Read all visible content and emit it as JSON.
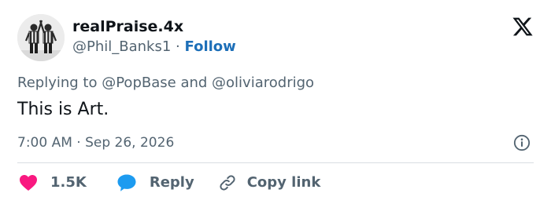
{
  "author": {
    "display_name": "realPraise.4x",
    "handle": "@Phil_Banks1",
    "separator": "·",
    "follow_label": "Follow"
  },
  "reply_context": {
    "prefix": "Replying to",
    "mention_1": "@PopBase",
    "conjunction": "and",
    "mention_2": "@oliviarodrigo"
  },
  "tweet": {
    "text": "This is Art.",
    "time": "7:00 AM",
    "separator": "·",
    "date": "Sep 26, 2026"
  },
  "actions": {
    "likes_count": "1.5K",
    "reply_label": "Reply",
    "copy_link_label": "Copy link"
  },
  "icons": {
    "brand": "x-logo-icon",
    "info": "info-icon",
    "like": "heart-icon",
    "reply": "speech-bubble-icon",
    "copy": "link-icon"
  },
  "colors": {
    "text": "#0f1419",
    "secondary": "#536471",
    "follow": "#1d6fb8",
    "heart": "#f91880",
    "reply_bubble": "#1d9bf0",
    "divider": "#d8dde2"
  }
}
